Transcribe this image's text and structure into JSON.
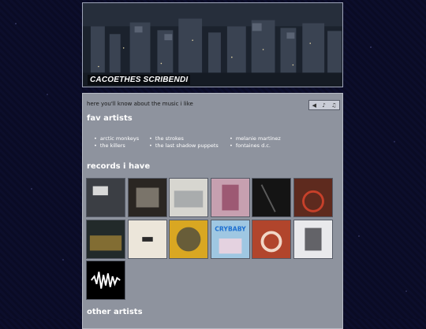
{
  "header": {
    "title": "CACOETHES SCRIBENDI"
  },
  "intro": "here you'll know about the music i like",
  "sections": {
    "fav_artists": "fav artists",
    "records": "records i have",
    "other_artists": "other artists"
  },
  "fav_artists": [
    "arctic monkeys",
    "the strokes",
    "melanie martinez",
    "the killers",
    "the last shadow puppets",
    "fontaines d.c."
  ],
  "albums": [
    {
      "icon": "album-cover-icon-1",
      "bg": "#3b3e44",
      "accent": "#d8d8d8",
      "text": ""
    },
    {
      "icon": "album-cover-icon-2",
      "bg": "#2a2622",
      "accent": "#c9c2b2",
      "text": ""
    },
    {
      "icon": "album-cover-icon-3",
      "bg": "#d7d6d0",
      "accent": "#8a9096",
      "text": ""
    },
    {
      "icon": "album-cover-icon-4",
      "bg": "#c7a0b0",
      "accent": "#8b3a5a",
      "text": ""
    },
    {
      "icon": "album-cover-icon-5",
      "bg": "#141414",
      "accent": "#5a5a5a",
      "text": ""
    },
    {
      "icon": "album-cover-icon-6",
      "bg": "#5e2a1e",
      "accent": "#c7402a",
      "text": ""
    },
    {
      "icon": "album-cover-icon-7",
      "bg": "#222a2a",
      "accent": "#d2a43a",
      "text": ""
    },
    {
      "icon": "album-cover-icon-8",
      "bg": "#ece6da",
      "accent": "#2a2a2a",
      "text": ""
    },
    {
      "icon": "album-cover-icon-9",
      "bg": "#d9a722",
      "accent": "#1d2c4a",
      "text": ""
    },
    {
      "icon": "album-cover-icon-10",
      "bg": "#9fc7e2",
      "accent": "#1d6fd0",
      "text": "CRYBABY"
    },
    {
      "icon": "album-cover-icon-11",
      "bg": "#b1452c",
      "accent": "#f1d7c7",
      "text": ""
    },
    {
      "icon": "album-cover-icon-12",
      "bg": "#e9e9ec",
      "accent": "#2a2a30",
      "text": ""
    },
    {
      "icon": "album-cover-icon-13",
      "bg": "#000000",
      "accent": "#ffffff",
      "text": ""
    }
  ]
}
